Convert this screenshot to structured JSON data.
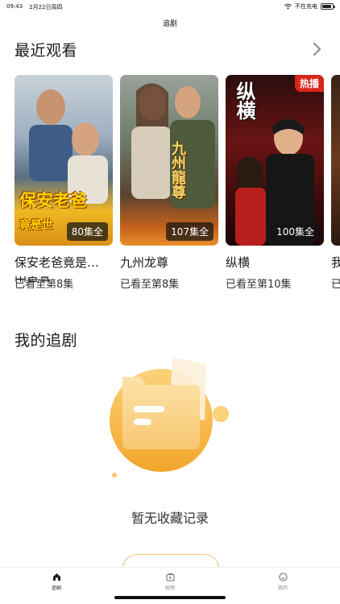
{
  "status_bar": {
    "time": "09:43",
    "date": "2月22日周四",
    "charging": "不在充电"
  },
  "nav": {
    "title": "追剧"
  },
  "recent": {
    "title": "最近观看",
    "items": [
      {
        "title": "保安老爸竟是…",
        "overflow_text": "田首富",
        "episodes": "80集全",
        "progress": "已看至第8集",
        "poster_line1": "保安老爸",
        "poster_line2": "竟是世"
      },
      {
        "title": "九州龙尊",
        "episodes": "107集全",
        "progress": "已看至第8集",
        "poster_text": "九州龍尊"
      },
      {
        "title": "纵横",
        "episodes": "100集全",
        "progress": "已看至第10集",
        "poster_text": "纵横",
        "hot": "热播"
      },
      {
        "title": "我",
        "progress": "已"
      }
    ]
  },
  "mine": {
    "title": "我的追剧",
    "empty_text": "暂无收藏记录"
  },
  "tabs": [
    {
      "label": "追剧",
      "icon": "home-icon",
      "active": true
    },
    {
      "label": "剧场",
      "icon": "theater-icon",
      "active": false
    },
    {
      "label": "我的",
      "icon": "profile-icon",
      "active": false
    }
  ],
  "colors": {
    "accent": "#f5a623",
    "empty_gradient_top": "#fbd27a",
    "empty_gradient_bottom": "#f3a52a",
    "hot_badge": "#d9261c"
  }
}
